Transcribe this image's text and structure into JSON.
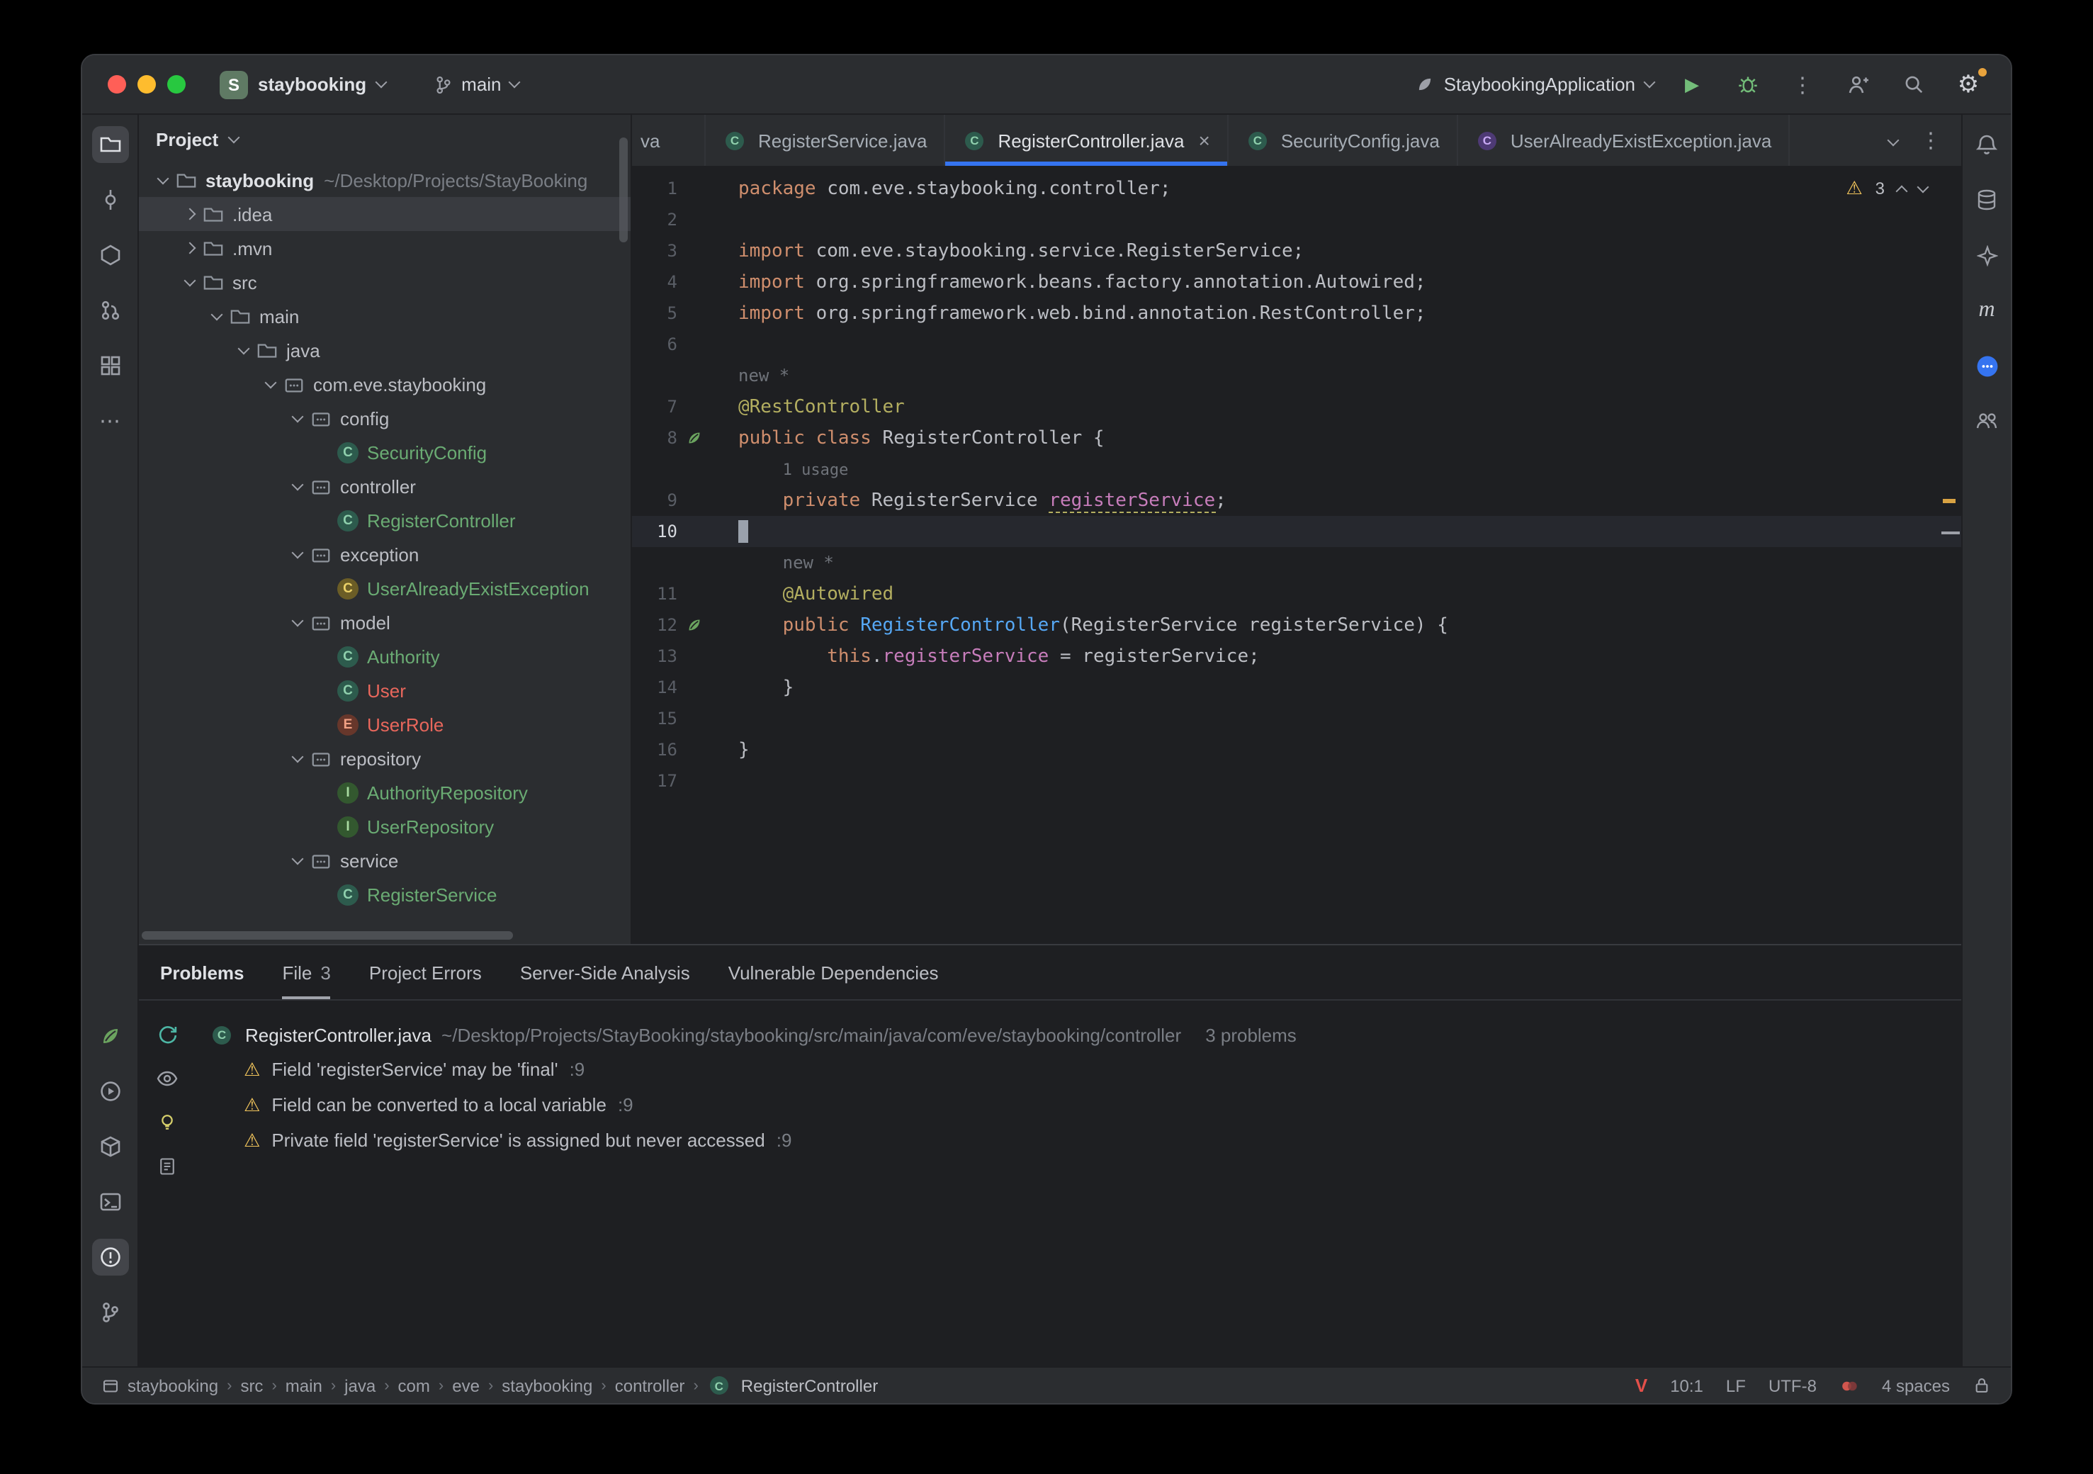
{
  "icons": {
    "gear": "⚙",
    "warning": "⚠",
    "run": "▶",
    "more_v": "⋮",
    "more_h": "⋯",
    "close": "×",
    "maven": "m"
  },
  "titlebar": {
    "project": {
      "initial": "S",
      "name": "staybooking"
    },
    "branch": "main",
    "run_config": "StaybookingApplication"
  },
  "project_panel": {
    "header": "Project",
    "tree": [
      {
        "label": "staybooking",
        "depth": 0,
        "icon": "folder",
        "chevron": "down",
        "bold": true,
        "extra": "~/Desktop/Projects/StayBooking"
      },
      {
        "label": ".idea",
        "depth": 1,
        "icon": "folder",
        "chevron": "right",
        "selected": true
      },
      {
        "label": ".mvn",
        "depth": 1,
        "icon": "folder",
        "chevron": "right"
      },
      {
        "label": "src",
        "depth": 1,
        "icon": "folder",
        "chevron": "down"
      },
      {
        "label": "main",
        "depth": 2,
        "icon": "folder",
        "chevron": "down"
      },
      {
        "label": "java",
        "depth": 3,
        "icon": "folder",
        "chevron": "down"
      },
      {
        "label": "com.eve.staybooking",
        "depth": 4,
        "icon": "package",
        "chevron": "down"
      },
      {
        "label": "config",
        "depth": 5,
        "icon": "package",
        "chevron": "down"
      },
      {
        "label": "SecurityConfig",
        "depth": 6,
        "icon": "class",
        "chevron": "none",
        "color": "green"
      },
      {
        "label": "controller",
        "depth": 5,
        "icon": "package",
        "chevron": "down"
      },
      {
        "label": "RegisterController",
        "depth": 6,
        "icon": "class",
        "chevron": "none",
        "color": "green"
      },
      {
        "label": "exception",
        "depth": 5,
        "icon": "package",
        "chevron": "down"
      },
      {
        "label": "UserAlreadyExistException",
        "depth": 6,
        "icon": "exception",
        "chevron": "none",
        "color": "green"
      },
      {
        "label": "model",
        "depth": 5,
        "icon": "package",
        "chevron": "down"
      },
      {
        "label": "Authority",
        "depth": 6,
        "icon": "class",
        "chevron": "none",
        "color": "green"
      },
      {
        "label": "User",
        "depth": 6,
        "icon": "class",
        "chevron": "none",
        "color": "red"
      },
      {
        "label": "UserRole",
        "depth": 6,
        "icon": "enum",
        "chevron": "none",
        "color": "red"
      },
      {
        "label": "repository",
        "depth": 5,
        "icon": "package",
        "chevron": "down"
      },
      {
        "label": "AuthorityRepository",
        "depth": 6,
        "icon": "interface",
        "chevron": "none",
        "color": "green"
      },
      {
        "label": "UserRepository",
        "depth": 6,
        "icon": "interface",
        "chevron": "none",
        "color": "green"
      },
      {
        "label": "service",
        "depth": 5,
        "icon": "package",
        "chevron": "down"
      },
      {
        "label": "RegisterService",
        "depth": 6,
        "icon": "class",
        "chevron": "none",
        "color": "green"
      }
    ]
  },
  "tabs": [
    {
      "label": "va",
      "icon": "none",
      "partial": true
    },
    {
      "label": "RegisterService.java",
      "icon": "class"
    },
    {
      "label": "RegisterController.java",
      "icon": "class",
      "active": true,
      "close": true
    },
    {
      "label": "SecurityConfig.java",
      "icon": "class"
    },
    {
      "label": "UserAlreadyExistException.java",
      "icon": "class-purple"
    }
  ],
  "editor": {
    "warning_count": "3",
    "lines": [
      {
        "n": 1,
        "tok": [
          [
            "kw",
            "package "
          ],
          [
            "t",
            "com.eve.staybooking.controller;"
          ]
        ]
      },
      {
        "n": 2,
        "tok": []
      },
      {
        "n": 3,
        "tok": [
          [
            "kw",
            "import "
          ],
          [
            "t",
            "com.eve.staybooking.service.RegisterService;"
          ]
        ]
      },
      {
        "n": 4,
        "tok": [
          [
            "kw",
            "import "
          ],
          [
            "t",
            "org.springframework.beans.factory.annotation.Autowired;"
          ]
        ]
      },
      {
        "n": 5,
        "tok": [
          [
            "kw",
            "import "
          ],
          [
            "t",
            "org.springframework.web.bind.annotation.RestController;"
          ]
        ]
      },
      {
        "n": 6,
        "tok": []
      },
      {
        "n": 7,
        "inlay": {
          "text": "new *",
          "col": 0
        },
        "tok": [
          [
            "ann",
            "@RestController"
          ]
        ]
      },
      {
        "n": 8,
        "gutter": "spring",
        "tok": [
          [
            "kw",
            "public class "
          ],
          [
            "t",
            "RegisterController {"
          ]
        ]
      },
      {
        "n": 9,
        "inlay": {
          "text": "1 usage",
          "col": 4,
          "small": true
        },
        "tok": [
          [
            "t",
            "    "
          ],
          [
            "kw",
            "private "
          ],
          [
            "t",
            "RegisterService "
          ],
          [
            "fieldw",
            "registerService"
          ],
          [
            "t",
            ";"
          ]
        ]
      },
      {
        "n": 10,
        "current": true,
        "cursor": true,
        "tok": []
      },
      {
        "n": 11,
        "inlay": {
          "text": "new *",
          "col": 4
        },
        "tok": [
          [
            "t",
            "    "
          ],
          [
            "ann",
            "@Autowired"
          ]
        ]
      },
      {
        "n": 12,
        "gutter": "spring",
        "tok": [
          [
            "t",
            "    "
          ],
          [
            "kw",
            "public "
          ],
          [
            "ctor",
            "RegisterController"
          ],
          [
            "t",
            "(RegisterService registerService) {"
          ]
        ]
      },
      {
        "n": 13,
        "tok": [
          [
            "t",
            "        "
          ],
          [
            "kw",
            "this"
          ],
          [
            "t",
            "."
          ],
          [
            "field",
            "registerService"
          ],
          [
            "t",
            " = registerService;"
          ]
        ]
      },
      {
        "n": 14,
        "tok": [
          [
            "t",
            "    }"
          ]
        ]
      },
      {
        "n": 15,
        "tok": []
      },
      {
        "n": 16,
        "tok": [
          [
            "t",
            "}"
          ]
        ]
      },
      {
        "n": 17,
        "tok": []
      }
    ]
  },
  "problems": {
    "tabs": [
      {
        "label": "Problems",
        "title": true
      },
      {
        "label": "File",
        "badge": "3",
        "active": true
      },
      {
        "label": "Project Errors"
      },
      {
        "label": "Server-Side Analysis"
      },
      {
        "label": "Vulnerable Dependencies"
      }
    ],
    "file": {
      "name": "RegisterController.java",
      "path": "~/Desktop/Projects/StayBooking/staybooking/src/main/java/com/eve/staybooking/controller",
      "count": "3 problems"
    },
    "items": [
      {
        "severity": "warning",
        "text": "Field 'registerService' may be 'final'",
        "loc": ":9"
      },
      {
        "severity": "warning",
        "text": "Field can be converted to a local variable",
        "loc": ":9"
      },
      {
        "severity": "warning",
        "text": "Private field 'registerService' is assigned but never accessed",
        "loc": ":9"
      }
    ]
  },
  "statusbar": {
    "breadcrumbs": [
      "staybooking",
      "src",
      "main",
      "java",
      "com",
      "eve",
      "staybooking",
      "controller"
    ],
    "breadcrumb_class": "RegisterController",
    "vim": "V",
    "caret": "10:1",
    "line_sep": "LF",
    "encoding": "UTF-8",
    "indent": "4 spaces"
  }
}
